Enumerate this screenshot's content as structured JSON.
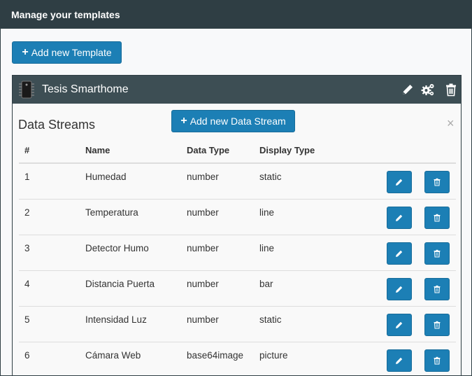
{
  "header": {
    "title": "Manage your templates"
  },
  "toolbar": {
    "add_template_label": "Add new Template",
    "add_template_icon": "plus-icon"
  },
  "template": {
    "name": "Tesis Smarthome",
    "icon": "chip-icon",
    "actions": [
      "edit-icon",
      "gears-icon",
      "trash-icon"
    ]
  },
  "datastreams": {
    "title": "Data Streams",
    "add_label": "Add new Data Stream",
    "close": "×",
    "columns": [
      "#",
      "Name",
      "Data Type",
      "Display Type"
    ],
    "rows": [
      {
        "num": "1",
        "name": "Humedad",
        "type": "number",
        "display": "static"
      },
      {
        "num": "2",
        "name": "Temperatura",
        "type": "number",
        "display": "line"
      },
      {
        "num": "3",
        "name": "Detector Humo",
        "type": "number",
        "display": "line"
      },
      {
        "num": "4",
        "name": "Distancia Puerta",
        "type": "number",
        "display": "bar"
      },
      {
        "num": "5",
        "name": "Intensidad Luz",
        "type": "number",
        "display": "static"
      },
      {
        "num": "6",
        "name": "Cámara Web",
        "type": "base64image",
        "display": "picture"
      }
    ]
  },
  "colors": {
    "header_bg": "#2f3e44",
    "panel_head_bg": "#3d4e54",
    "button_blue": "#1c7fb5"
  }
}
